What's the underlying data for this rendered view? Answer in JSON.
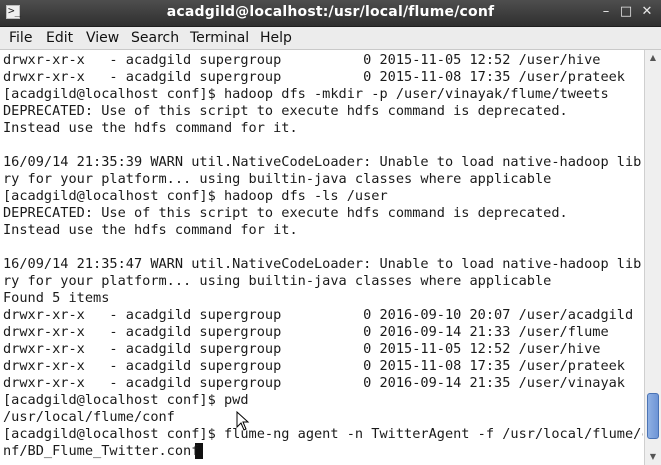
{
  "window": {
    "title": "acadgild@localhost:/usr/local/flume/conf",
    "minimize_glyph": "–",
    "maximize_glyph": "□",
    "close_glyph": "✕",
    "app_icon_glyph": ">_"
  },
  "menu": [
    "File",
    "Edit",
    "View",
    "Search",
    "Terminal",
    "Help"
  ],
  "terminal": {
    "lines": [
      "drwxr-xr-x   - acadgild supergroup          0 2015-11-05 12:52 /user/hive",
      "drwxr-xr-x   - acadgild supergroup          0 2015-11-08 17:35 /user/prateek",
      "[acadgild@localhost conf]$ hadoop dfs -mkdir -p /user/vinayak/flume/tweets",
      "DEPRECATED: Use of this script to execute hdfs command is deprecated.",
      "Instead use the hdfs command for it.",
      "",
      "16/09/14 21:35:39 WARN util.NativeCodeLoader: Unable to load native-hadoop libra",
      "ry for your platform... using builtin-java classes where applicable",
      "[acadgild@localhost conf]$ hadoop dfs -ls /user",
      "DEPRECATED: Use of this script to execute hdfs command is deprecated.",
      "Instead use the hdfs command for it.",
      "",
      "16/09/14 21:35:47 WARN util.NativeCodeLoader: Unable to load native-hadoop libra",
      "ry for your platform... using builtin-java classes where applicable",
      "Found 5 items",
      "drwxr-xr-x   - acadgild supergroup          0 2016-09-10 20:07 /user/acadgild",
      "drwxr-xr-x   - acadgild supergroup          0 2016-09-14 21:33 /user/flume",
      "drwxr-xr-x   - acadgild supergroup          0 2015-11-05 12:52 /user/hive",
      "drwxr-xr-x   - acadgild supergroup          0 2015-11-08 17:35 /user/prateek",
      "drwxr-xr-x   - acadgild supergroup          0 2016-09-14 21:35 /user/vinayak",
      "[acadgild@localhost conf]$ pwd",
      "/usr/local/flume/conf",
      "[acadgild@localhost conf]$ flume-ng agent -n TwitterAgent -f /usr/local/flume/co",
      "nf/BD_Flume_Twitter.conf"
    ]
  },
  "scrollbar": {
    "position_fraction": 0.97,
    "visible_fraction": 0.12
  }
}
